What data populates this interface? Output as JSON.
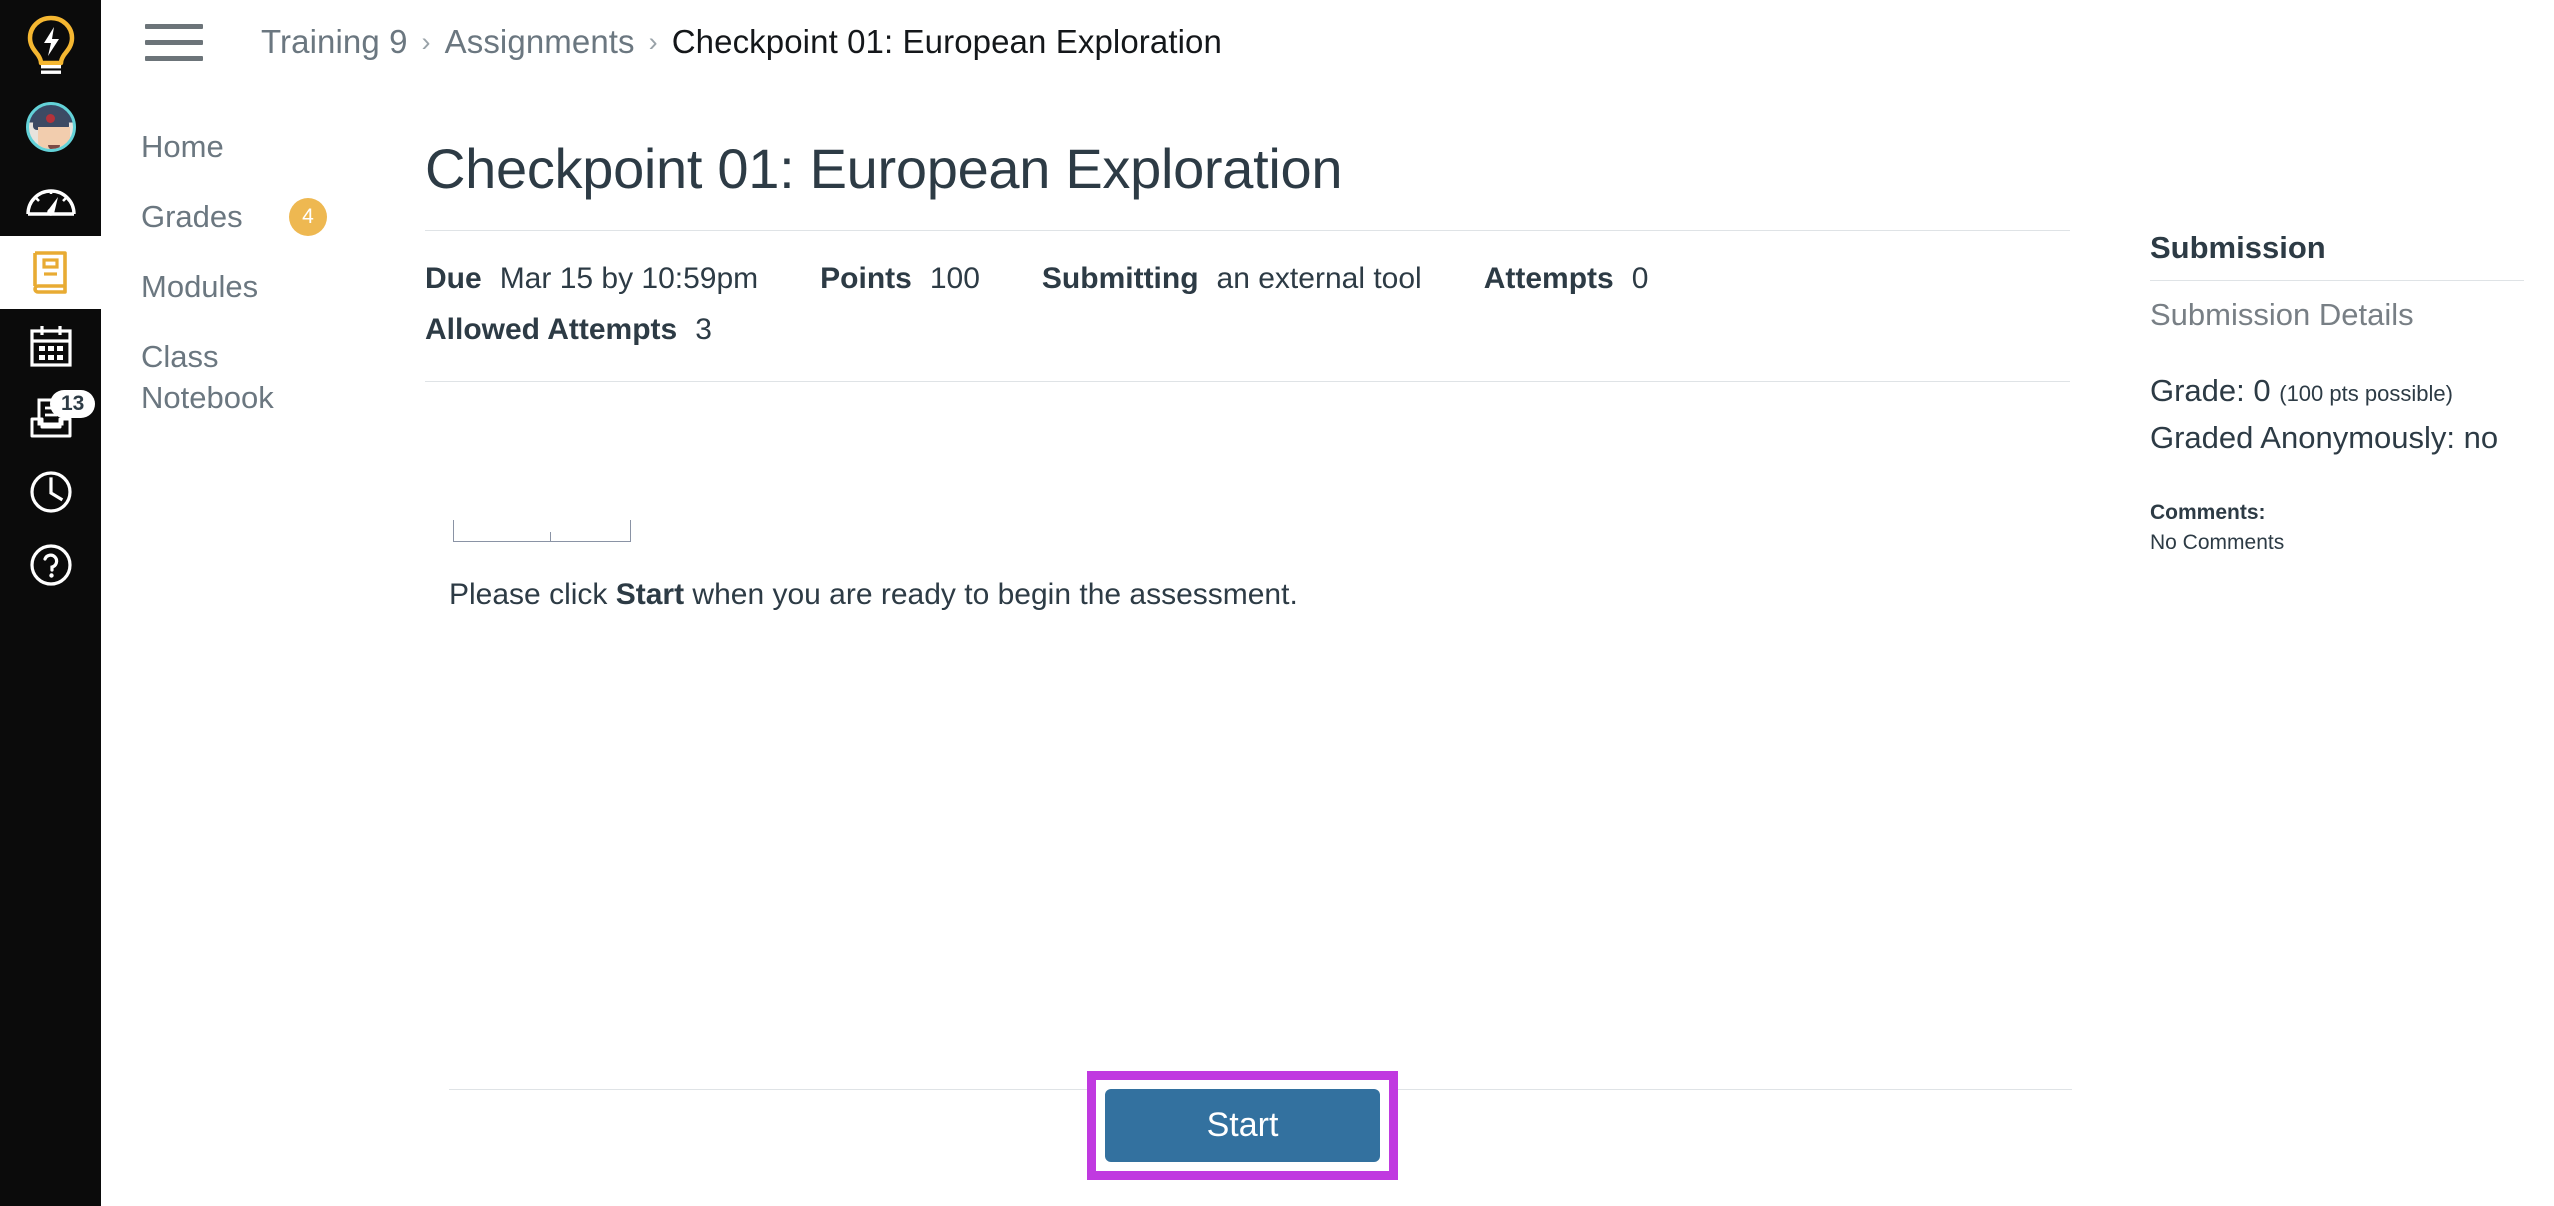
{
  "global_nav": {
    "logo": {
      "icon": "lightbulb-icon",
      "label": "Canvas Logo"
    },
    "items": [
      {
        "id": "account",
        "icon": "avatar",
        "label": "Account",
        "badge": null
      },
      {
        "id": "dashboard",
        "icon": "dashboard-icon",
        "label": "Dashboard",
        "badge": null
      },
      {
        "id": "courses",
        "icon": "courses-icon",
        "label": "Courses",
        "badge": null,
        "active": true
      },
      {
        "id": "calendar",
        "icon": "calendar-icon",
        "label": "Calendar",
        "badge": null
      },
      {
        "id": "inbox",
        "icon": "inbox-icon",
        "label": "Inbox",
        "badge": "13"
      },
      {
        "id": "history",
        "icon": "clock-icon",
        "label": "History",
        "badge": null
      },
      {
        "id": "help",
        "icon": "help-icon",
        "label": "Help",
        "badge": null
      }
    ]
  },
  "topbar": {
    "menu_icon": "hamburger-icon",
    "breadcrumb": [
      {
        "label": "Training 9",
        "current": false
      },
      {
        "label": "Assignments",
        "current": false
      },
      {
        "label": "Checkpoint 01: European Exploration",
        "current": true
      }
    ],
    "separator": "›"
  },
  "course_nav": {
    "items": [
      {
        "label": "Home",
        "badge": null
      },
      {
        "label": "Grades",
        "badge": "4"
      },
      {
        "label": "Modules",
        "badge": null
      },
      {
        "label": "Class Notebook",
        "badge": null
      }
    ]
  },
  "assignment": {
    "title": "Checkpoint 01: European Exploration",
    "details": [
      {
        "label": "Due",
        "value": "Mar 15 by 10:59pm"
      },
      {
        "label": "Points",
        "value": "100"
      },
      {
        "label": "Submitting",
        "value": "an external tool"
      },
      {
        "label": "Attempts",
        "value": "0"
      },
      {
        "label": "Allowed Attempts",
        "value": "3"
      }
    ],
    "tool": {
      "instruction_prefix": "Please click ",
      "instruction_bold": "Start",
      "instruction_suffix": " when you are ready to begin the assessment."
    },
    "start_button": {
      "label": "Start",
      "background": "#33719f",
      "highlight_color": "#c03ae0"
    }
  },
  "submission": {
    "heading": "Submission",
    "details_link": "Submission Details",
    "grade_line": "Grade: 0",
    "grade_possible": "(100 pts possible)",
    "anonymous_line": "Graded Anonymously: no",
    "comments_label": "Comments:",
    "comments_value": "No Comments"
  },
  "colors": {
    "nav_background": "#0b0b0b",
    "accent_orange": "#eeb851",
    "brand_blue": "#33719f",
    "highlight_purple": "#c03ae0",
    "text_primary": "#2d3b45",
    "text_secondary": "#6b7780"
  }
}
